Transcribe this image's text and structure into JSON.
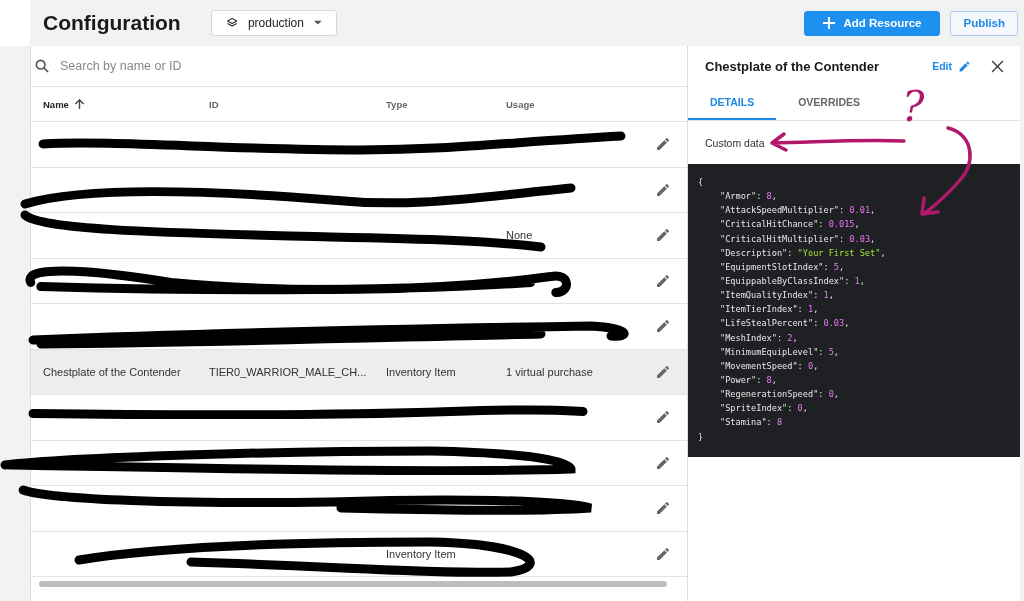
{
  "header": {
    "title": "Configuration",
    "environment": "production",
    "buttons": [
      {
        "label": "Add Resource",
        "kind": "primary"
      },
      {
        "label": "Publish",
        "kind": "outline"
      }
    ]
  },
  "search": {
    "placeholder": "Search by name or ID"
  },
  "table": {
    "columns": [
      {
        "label": "Name",
        "sorted": true
      },
      {
        "label": "ID",
        "sorted": false
      },
      {
        "label": "Type",
        "sorted": false
      },
      {
        "label": "Usage",
        "sorted": false
      }
    ],
    "rows": [
      {
        "redacted": true,
        "selected": false
      },
      {
        "redacted": true,
        "selected": false
      },
      {
        "redacted": true,
        "selected": false,
        "usage": "None"
      },
      {
        "redacted": true,
        "selected": false
      },
      {
        "redacted": true,
        "selected": false
      },
      {
        "redacted": false,
        "selected": true,
        "name": "Chestplate of the Contender",
        "id": "TIER0_WARRIOR_MALE_CH...",
        "type": "Inventory Item",
        "usage": "1 virtual purchase"
      },
      {
        "redacted": true,
        "selected": false
      },
      {
        "redacted": true,
        "selected": false
      },
      {
        "redacted": true,
        "selected": false
      },
      {
        "redacted": true,
        "selected": false,
        "type": "Inventory Item"
      }
    ]
  },
  "detail": {
    "title": "Chestplate of the Contender",
    "edit": "Edit",
    "tabs": [
      {
        "label": "DETAILS",
        "selected": true
      },
      {
        "label": "OVERRIDES",
        "selected": false
      }
    ],
    "section_label": "Custom data",
    "code": {
      "open": "{",
      "close": "}",
      "entries": [
        {
          "key": "\"Armor\": ",
          "value": "8",
          "kind": "number",
          "tail": ","
        },
        {
          "key": "\"AttackSpeedMultiplier\": ",
          "value": "0.01",
          "kind": "number",
          "tail": ","
        },
        {
          "key": "\"CriticalHitChance\": ",
          "value": "0.015",
          "kind": "number",
          "tail": ","
        },
        {
          "key": "\"CriticalHitMultiplier\": ",
          "value": "0.03",
          "kind": "number",
          "tail": ","
        },
        {
          "key": "\"Description\": ",
          "value": "\"Your First Set\"",
          "kind": "string",
          "tail": ","
        },
        {
          "key": "\"EquipmentSlotIndex\": ",
          "value": "5",
          "kind": "number",
          "tail": ","
        },
        {
          "key": "\"EquippableByClassIndex\": ",
          "value": "1",
          "kind": "number",
          "tail": ","
        },
        {
          "key": "\"ItemQualityIndex\": ",
          "value": "1",
          "kind": "number",
          "tail": ","
        },
        {
          "key": "\"ItemTierIndex\": ",
          "value": "1",
          "kind": "number",
          "tail": ","
        },
        {
          "key": "\"LifeStealPercent\": ",
          "value": "0.03",
          "kind": "number",
          "tail": ","
        },
        {
          "key": "\"MeshIndex\": ",
          "value": "2",
          "kind": "number",
          "tail": ","
        },
        {
          "key": "\"MinimumEquipLevel\": ",
          "value": "5",
          "kind": "number",
          "tail": ","
        },
        {
          "key": "\"MovementSpeed\": ",
          "value": "0",
          "kind": "number",
          "tail": ","
        },
        {
          "key": "\"Power\": ",
          "value": "8",
          "kind": "number",
          "tail": ","
        },
        {
          "key": "\"RegenerationSpeed\": ",
          "value": "0",
          "kind": "number",
          "tail": ","
        },
        {
          "key": "\"SpriteIndex\": ",
          "value": "0",
          "kind": "number",
          "tail": ","
        },
        {
          "key": "\"Stamina\": ",
          "value": "8",
          "kind": "number"
        }
      ]
    }
  },
  "annotation": {
    "mark": "?"
  }
}
